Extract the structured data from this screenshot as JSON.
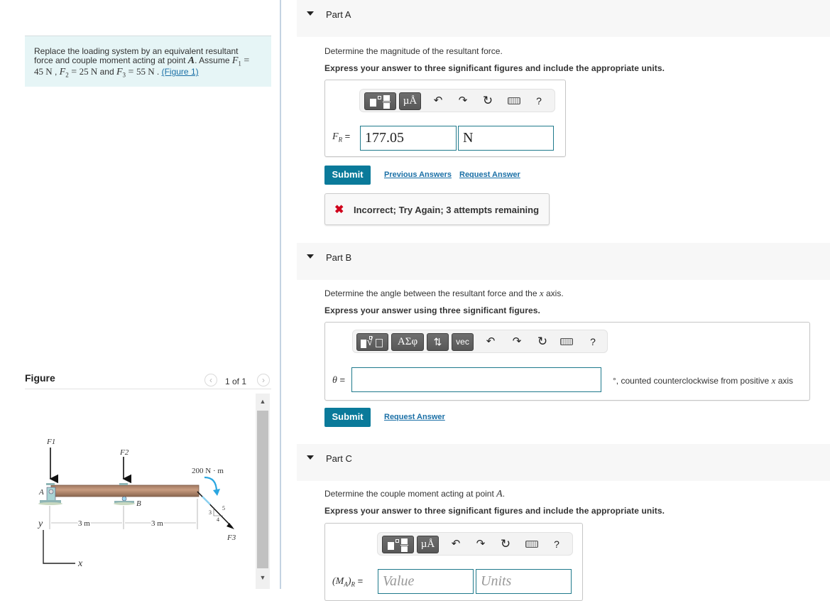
{
  "problem": {
    "line1": "Replace the loading system by an equivalent resultant",
    "line2_prefix": "force and couple moment acting at point ",
    "point": "A",
    "line2_mid": ". Assume ",
    "f1_sym": "F",
    "f1_sub": "1",
    "equals": " = ",
    "f1_val": "45 N",
    "sep1": " , ",
    "f2_sym": "F",
    "f2_sub": "2",
    "f2_val": "25 N",
    "and": " and ",
    "f3_sym": "F",
    "f3_sub": "3",
    "f3_val": "55 N",
    "sep2": " . ",
    "figure_link": "(Figure 1)"
  },
  "figure": {
    "title": "Figure",
    "pager": "1 of 1",
    "prev_icon": "chevron-left-icon",
    "next_icon": "chevron-right-icon",
    "labels": {
      "f1": "F1",
      "f2": "F2",
      "f3": "F3",
      "a": "A",
      "b": "B",
      "moment": "200 N · m",
      "dim1": "3 m",
      "dim2": "3 m",
      "y": "y",
      "x": "x",
      "slope_3": "3",
      "slope_4": "4",
      "slope_5": "5"
    }
  },
  "parts": [
    {
      "label": "Part A",
      "question": "Determine the magnitude of the resultant force.",
      "instruction": "Express your answer to three significant figures and include the appropriate units.",
      "toolbar": [
        "templates",
        "µÅ",
        "undo",
        "redo",
        "reset",
        "keyboard",
        "?"
      ],
      "variable": "F",
      "variable_sub": "R",
      "value": "177.05",
      "units": "N",
      "submit": "Submit",
      "links": [
        "Previous Answers",
        "Request Answer"
      ],
      "feedback": "Incorrect; Try Again; 3 attempts remaining"
    },
    {
      "label": "Part B",
      "question_prefix": "Determine the angle between the resultant force and the ",
      "question_var": "x",
      "question_suffix": " axis.",
      "instruction": "Express your answer using three significant figures.",
      "toolbar": [
        "templates",
        "ΑΣφ",
        "⇅",
        "vec",
        "undo",
        "redo",
        "reset",
        "keyboard",
        "?"
      ],
      "variable": "θ",
      "value": "",
      "suffix_prefix": "°, counted counterclockwise from positive ",
      "suffix_var": "x",
      "suffix_end": " axis",
      "submit": "Submit",
      "links": [
        "Request Answer"
      ]
    },
    {
      "label": "Part C",
      "question_prefix": "Determine the couple moment acting at point ",
      "question_var": "A",
      "question_suffix": ".",
      "instruction": "Express your answer to three significant figures and include the appropriate units.",
      "toolbar": [
        "templates",
        "µÅ",
        "undo",
        "redo",
        "reset",
        "keyboard",
        "?"
      ],
      "variable": "(M",
      "variable_sub": "A",
      "variable_end": ")",
      "variable_sub2": "R",
      "value_placeholder": "Value",
      "units_placeholder": "Units"
    }
  ],
  "colors": {
    "accent": "#0a7a9a",
    "link": "#1a6fa6",
    "error": "#d0021b",
    "field_border": "#1f7a8c",
    "problem_bg": "#e6f5f6"
  }
}
